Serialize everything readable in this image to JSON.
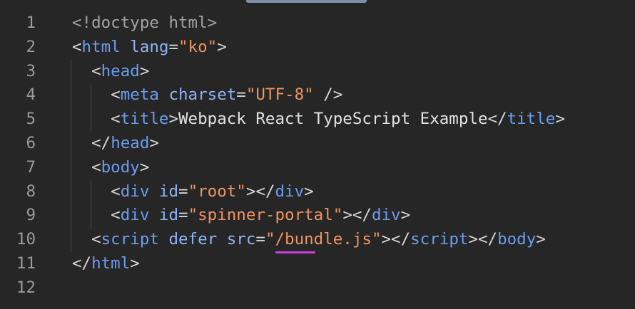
{
  "editor": {
    "lines": [
      {
        "number": "1",
        "tokens": [
          {
            "t": "doctype",
            "v": "<!doctype html>"
          }
        ]
      },
      {
        "number": "2",
        "tokens": [
          {
            "t": "punct",
            "v": "<"
          },
          {
            "t": "tag",
            "v": "html"
          },
          {
            "t": "punct",
            "v": " "
          },
          {
            "t": "attr",
            "v": "lang"
          },
          {
            "t": "punct",
            "v": "="
          },
          {
            "t": "str",
            "v": "\"ko\""
          },
          {
            "t": "punct",
            "v": ">"
          }
        ]
      },
      {
        "number": "3",
        "tokens": [
          {
            "t": "punct",
            "v": "  <"
          },
          {
            "t": "tag",
            "v": "head"
          },
          {
            "t": "punct",
            "v": ">"
          }
        ]
      },
      {
        "number": "4",
        "tokens": [
          {
            "t": "punct",
            "v": "    <"
          },
          {
            "t": "tag",
            "v": "meta"
          },
          {
            "t": "punct",
            "v": " "
          },
          {
            "t": "attr",
            "v": "charset"
          },
          {
            "t": "punct",
            "v": "="
          },
          {
            "t": "str",
            "v": "\"UTF-8\""
          },
          {
            "t": "punct",
            "v": " />"
          }
        ]
      },
      {
        "number": "5",
        "tokens": [
          {
            "t": "punct",
            "v": "    <"
          },
          {
            "t": "tag",
            "v": "title"
          },
          {
            "t": "punct",
            "v": ">"
          },
          {
            "t": "text",
            "v": "Webpack React TypeScript Example"
          },
          {
            "t": "punct",
            "v": "</"
          },
          {
            "t": "tag",
            "v": "title"
          },
          {
            "t": "punct",
            "v": ">"
          }
        ]
      },
      {
        "number": "6",
        "tokens": [
          {
            "t": "punct",
            "v": "  </"
          },
          {
            "t": "tag",
            "v": "head"
          },
          {
            "t": "punct",
            "v": ">"
          }
        ]
      },
      {
        "number": "7",
        "tokens": [
          {
            "t": "punct",
            "v": "  <"
          },
          {
            "t": "tag",
            "v": "body"
          },
          {
            "t": "punct",
            "v": ">"
          }
        ]
      },
      {
        "number": "8",
        "tokens": [
          {
            "t": "punct",
            "v": "    <"
          },
          {
            "t": "tag",
            "v": "div"
          },
          {
            "t": "punct",
            "v": " "
          },
          {
            "t": "attr",
            "v": "id"
          },
          {
            "t": "punct",
            "v": "="
          },
          {
            "t": "str",
            "v": "\"root\""
          },
          {
            "t": "punct",
            "v": "></"
          },
          {
            "t": "tag",
            "v": "div"
          },
          {
            "t": "punct",
            "v": ">"
          }
        ]
      },
      {
        "number": "9",
        "tokens": [
          {
            "t": "punct",
            "v": "    <"
          },
          {
            "t": "tag",
            "v": "div"
          },
          {
            "t": "punct",
            "v": " "
          },
          {
            "t": "attr",
            "v": "id"
          },
          {
            "t": "punct",
            "v": "="
          },
          {
            "t": "str",
            "v": "\"spinner-portal\""
          },
          {
            "t": "punct",
            "v": "></"
          },
          {
            "t": "tag",
            "v": "div"
          },
          {
            "t": "punct",
            "v": ">"
          }
        ]
      },
      {
        "number": "10",
        "tokens": [
          {
            "t": "punct",
            "v": "  <"
          },
          {
            "t": "tag",
            "v": "script"
          },
          {
            "t": "punct",
            "v": " "
          },
          {
            "t": "attr",
            "v": "defer"
          },
          {
            "t": "punct",
            "v": " "
          },
          {
            "t": "attr",
            "v": "src"
          },
          {
            "t": "punct",
            "v": "="
          },
          {
            "t": "str",
            "v": "\"/bundle.js\""
          },
          {
            "t": "punct",
            "v": "></"
          },
          {
            "t": "tag",
            "v": "script"
          },
          {
            "t": "punct",
            "v": "></"
          },
          {
            "t": "tag",
            "v": "body"
          },
          {
            "t": "punct",
            "v": ">"
          }
        ]
      },
      {
        "number": "11",
        "tokens": [
          {
            "t": "punct",
            "v": "</"
          },
          {
            "t": "tag",
            "v": "html"
          },
          {
            "t": "punct",
            "v": ">"
          }
        ]
      },
      {
        "number": "12",
        "tokens": []
      }
    ]
  },
  "colors": {
    "background": "#262626",
    "line_number": "#9a9a9a",
    "tag": "#6b9cf0",
    "attribute": "#8fb2f5",
    "string": "#ef9360",
    "text": "#e2e2e2",
    "squiggle": "#d13fe0"
  }
}
